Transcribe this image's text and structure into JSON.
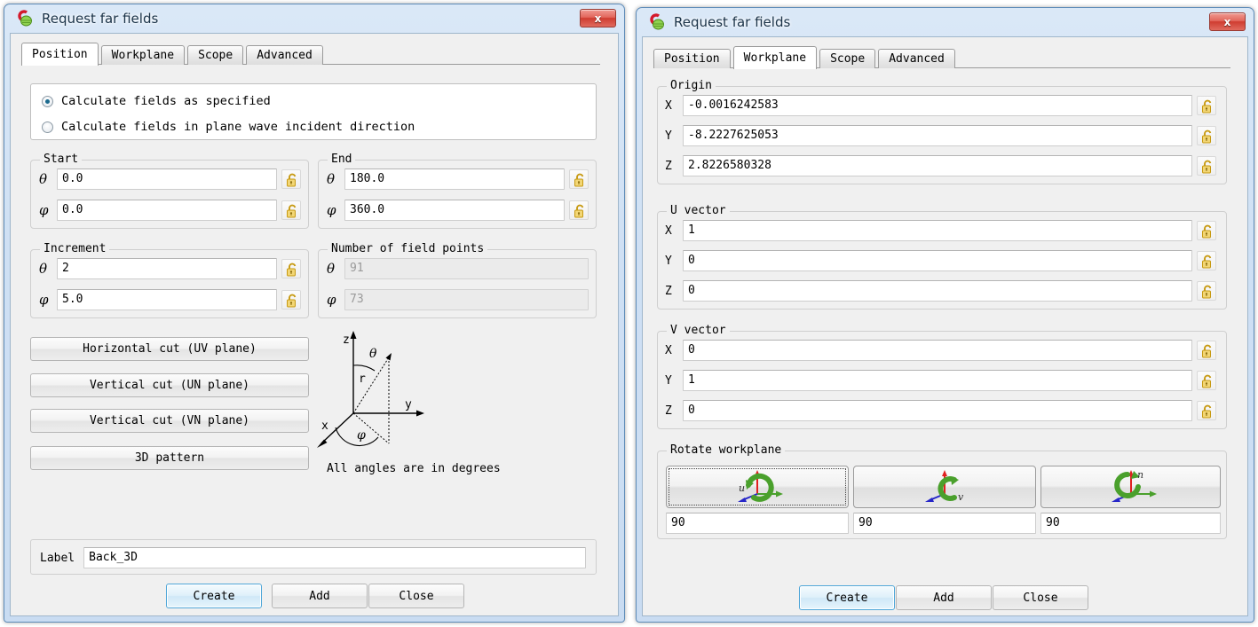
{
  "windows": {
    "left": {
      "title": "Request far fields",
      "close_label": "x",
      "tabs": [
        {
          "label": "Position",
          "active": true
        },
        {
          "label": "Workplane",
          "active": false
        },
        {
          "label": "Scope",
          "active": false
        },
        {
          "label": "Advanced",
          "active": false
        }
      ],
      "radios": [
        {
          "label": "Calculate fields as specified",
          "checked": true
        },
        {
          "label": "Calculate fields in plane wave incident direction",
          "checked": false
        }
      ],
      "groups": {
        "start": {
          "legend": "Start",
          "fields": [
            {
              "symbol": "θ",
              "value": "0.0",
              "locked": false,
              "disabled": false
            },
            {
              "symbol": "φ",
              "value": "0.0",
              "locked": false,
              "disabled": false
            }
          ]
        },
        "end": {
          "legend": "End",
          "fields": [
            {
              "symbol": "θ",
              "value": "180.0",
              "locked": false,
              "disabled": false
            },
            {
              "symbol": "φ",
              "value": "360.0",
              "locked": false,
              "disabled": false
            }
          ]
        },
        "increment": {
          "legend": "Increment",
          "fields": [
            {
              "symbol": "θ",
              "value": "2",
              "locked": false,
              "disabled": false
            },
            {
              "symbol": "φ",
              "value": "5.0",
              "locked": false,
              "disabled": false
            }
          ]
        },
        "number_of_field_points": {
          "legend": "Number of field points",
          "fields": [
            {
              "symbol": "θ",
              "value": "91",
              "disabled": true
            },
            {
              "symbol": "φ",
              "value": "73",
              "disabled": true
            }
          ]
        }
      },
      "cut_buttons": [
        "Horizontal cut (UV plane)",
        "Vertical cut (UN plane)",
        "Vertical cut (VN plane)",
        "3D pattern"
      ],
      "diagram": {
        "axis_z": "z",
        "axis_y": "y",
        "axis_x": "x",
        "angle_theta": "θ",
        "angle_phi": "φ",
        "radius": "r",
        "caption": "All angles are in degrees"
      },
      "label_field": {
        "label": "Label",
        "value": "Back_3D"
      },
      "dialog_buttons": [
        {
          "label": "Create",
          "primary": true
        },
        {
          "label": "Add",
          "primary": false
        },
        {
          "label": "Close",
          "primary": false
        }
      ]
    },
    "right": {
      "title": "Request far fields",
      "close_label": "x",
      "tabs": [
        {
          "label": "Position",
          "active": false
        },
        {
          "label": "Workplane",
          "active": true
        },
        {
          "label": "Scope",
          "active": false
        },
        {
          "label": "Advanced",
          "active": false
        }
      ],
      "groups": {
        "origin": {
          "legend": "Origin",
          "fields": [
            {
              "symbol": "X",
              "value": "-0.0016242583",
              "locked": false
            },
            {
              "symbol": "Y",
              "value": "-8.2227625053",
              "locked": false
            },
            {
              "symbol": "Z",
              "value": "2.8226580328",
              "locked": false
            }
          ]
        },
        "u_vector": {
          "legend": "U vector",
          "fields": [
            {
              "symbol": "X",
              "value": "1",
              "locked": false
            },
            {
              "symbol": "Y",
              "value": "0",
              "locked": false
            },
            {
              "symbol": "Z",
              "value": "0",
              "locked": false
            }
          ]
        },
        "v_vector": {
          "legend": "V vector",
          "fields": [
            {
              "symbol": "X",
              "value": "0",
              "locked": false
            },
            {
              "symbol": "Y",
              "value": "1",
              "locked": false
            },
            {
              "symbol": "Z",
              "value": "0",
              "locked": false
            }
          ]
        },
        "rotate_workplane": {
          "legend": "Rotate workplane",
          "buttons": [
            {
              "icon": "rotate-about-u-icon",
              "axis_label": "u",
              "angle": "90",
              "focused": true
            },
            {
              "icon": "rotate-about-v-icon",
              "axis_label": "v",
              "angle": "90",
              "focused": false
            },
            {
              "icon": "rotate-about-n-icon",
              "axis_label": "n",
              "angle": "90",
              "focused": false
            }
          ]
        }
      },
      "dialog_buttons": [
        {
          "label": "Create",
          "primary": true
        },
        {
          "label": "Add",
          "primary": false
        },
        {
          "label": "Close",
          "primary": false
        }
      ]
    }
  },
  "colors": {
    "frame": "#cfe0f4",
    "accent": "#4ea6d8",
    "close_red": "#cf3c30",
    "lock_gold": "#e3b517",
    "axis_red": "#e02020",
    "axis_green": "#4aa02c",
    "axis_blue": "#2626c8"
  }
}
